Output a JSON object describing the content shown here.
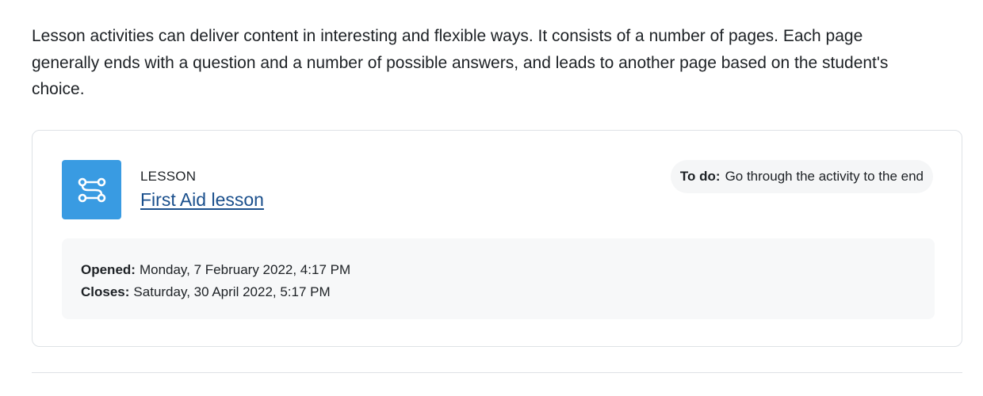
{
  "intro_text": "Lesson activities can deliver content in interesting and flexible ways. It consists of a number of pages. Each page generally ends with a question and a number of possible answers, and leads to another page based on the student's choice.",
  "activity": {
    "type_label": "LESSON",
    "name": "First Aid lesson",
    "icon": "lesson-route-icon",
    "icon_bg_color": "#399be2",
    "todo": {
      "label": "To do:",
      "text": "Go through the activity to the end"
    },
    "dates": {
      "opened_label": "Opened:",
      "opened_value": "Monday, 7 February 2022, 4:17 PM",
      "closes_label": "Closes:",
      "closes_value": "Saturday, 30 April 2022, 5:17 PM"
    }
  },
  "colors": {
    "link": "#1a4f8c",
    "text": "#1d2125",
    "border": "#dee2e6"
  }
}
